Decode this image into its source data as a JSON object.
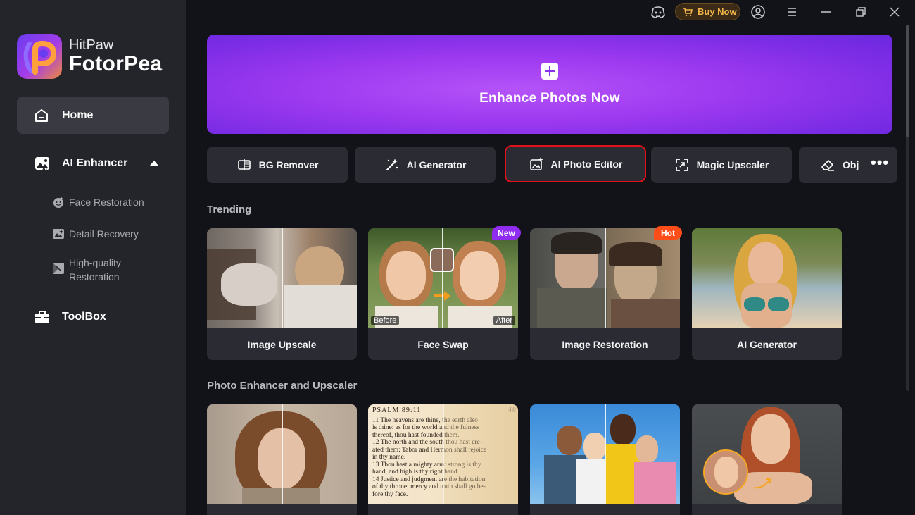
{
  "app": {
    "brand_line1": "HitPaw",
    "brand_line2": "FotorPea"
  },
  "titlebar": {
    "buy_now": "Buy Now",
    "icons": [
      "discord-icon",
      "cart-icon",
      "account-icon",
      "menu-icon",
      "minimize-icon",
      "restore-icon",
      "close-icon"
    ]
  },
  "sidebar": {
    "home": "Home",
    "ai_enhancer": "AI Enhancer",
    "sub_items": [
      {
        "label": "Face Restoration"
      },
      {
        "label": "Detail Recovery"
      },
      {
        "label1": "High-quality",
        "label2": "Restoration"
      }
    ],
    "toolbox": "ToolBox"
  },
  "hero": {
    "title": "Enhance Photos Now"
  },
  "tools": [
    {
      "label": "BG Remover",
      "icon": "bg-remover-icon"
    },
    {
      "label": "AI Generator",
      "icon": "magic-wand-icon"
    },
    {
      "label": "AI Photo Editor",
      "icon": "photo-edit-icon",
      "selected": true
    },
    {
      "label": "Magic Upscaler",
      "icon": "upscale-icon"
    },
    {
      "label": "Obj",
      "icon": "eraser-icon"
    }
  ],
  "sections": {
    "trending": "Trending",
    "enhancer": "Photo Enhancer and Upscaler"
  },
  "trending_cards": [
    {
      "label": "Image Upscale"
    },
    {
      "label": "Face Swap",
      "badge": "New",
      "before": "Before",
      "after": "After"
    },
    {
      "label": "Image Restoration",
      "badge": "Hot"
    },
    {
      "label": "AI Generator"
    }
  ],
  "bible": {
    "heading": "PSALM 89:11",
    "page_num": "48",
    "lines": [
      "11  The heavens are thine, the earth also",
      "is thine: as for the world and the fulness",
      "thereof, thou hast founded them.",
      "12  The north and the south thou hast cre-",
      "ated them: Tabor and Hermon shall rejoice",
      "in thy name.",
      "13  Thou hast a mighty arm: strong is thy",
      "hand, and high is thy right hand.",
      "14  Justice and judgment are the habitation",
      "of thy throne: mercy and truth shall go be-",
      "fore thy face."
    ]
  },
  "colors": {
    "sidebar_bg": "#24252b",
    "main_bg": "#121318",
    "card_bg": "#2b2c33",
    "hero_purple": "#9e3af0",
    "selection_red": "#e0111a",
    "new_badge": "#8f2cf0",
    "hot_badge": "#ff4d1a",
    "buy_now_gold": "#f2b54a"
  }
}
